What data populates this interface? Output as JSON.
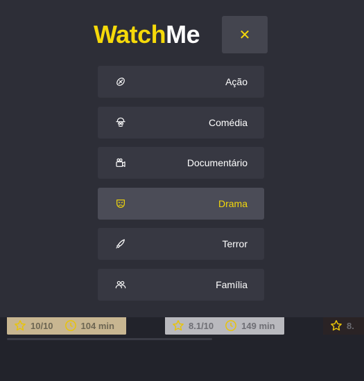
{
  "logo": {
    "part1": "Watch",
    "part2": "Me"
  },
  "close_button": {
    "glyph": "✕"
  },
  "menu": {
    "items": [
      {
        "label": "Ação",
        "icon": "action-icon",
        "active": false
      },
      {
        "label": "Comédia",
        "icon": "comedy-icon",
        "active": false
      },
      {
        "label": "Documentário",
        "icon": "documentary-icon",
        "active": false
      },
      {
        "label": "Drama",
        "icon": "drama-icon",
        "active": true
      },
      {
        "label": "Terror",
        "icon": "horror-icon",
        "active": false
      },
      {
        "label": "Família",
        "icon": "family-icon",
        "active": false
      }
    ]
  },
  "movies": [
    {
      "rating": "10/10",
      "runtime": "104 min"
    },
    {
      "rating": "8.1/10",
      "runtime": "149 min"
    },
    {
      "rating": "8."
    }
  ],
  "colors": {
    "accent": "#f5d90a",
    "background": "#22232b",
    "sidebar": "#2d2e37",
    "menu_item": "#373842",
    "menu_item_active": "#4b4c57"
  }
}
